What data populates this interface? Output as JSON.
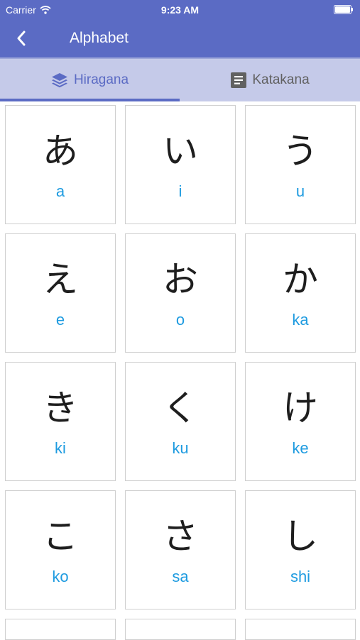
{
  "status_bar": {
    "carrier": "Carrier",
    "time": "9:23 AM"
  },
  "app_bar": {
    "title": "Alphabet"
  },
  "tabs": [
    {
      "label": "Hiragana",
      "icon": "layers-icon",
      "active": true
    },
    {
      "label": "Katakana",
      "icon": "document-icon",
      "active": false
    }
  ],
  "colors": {
    "primary": "#5b6bc4",
    "tab_bg": "#c5cae9",
    "romaji": "#1e9be0"
  },
  "characters": [
    {
      "kana": "あ",
      "romaji": "a"
    },
    {
      "kana": "い",
      "romaji": "i"
    },
    {
      "kana": "う",
      "romaji": "u"
    },
    {
      "kana": "え",
      "romaji": "e"
    },
    {
      "kana": "お",
      "romaji": "o"
    },
    {
      "kana": "か",
      "romaji": "ka"
    },
    {
      "kana": "き",
      "romaji": "ki"
    },
    {
      "kana": "く",
      "romaji": "ku"
    },
    {
      "kana": "け",
      "romaji": "ke"
    },
    {
      "kana": "こ",
      "romaji": "ko"
    },
    {
      "kana": "さ",
      "romaji": "sa"
    },
    {
      "kana": "し",
      "romaji": "shi"
    }
  ]
}
